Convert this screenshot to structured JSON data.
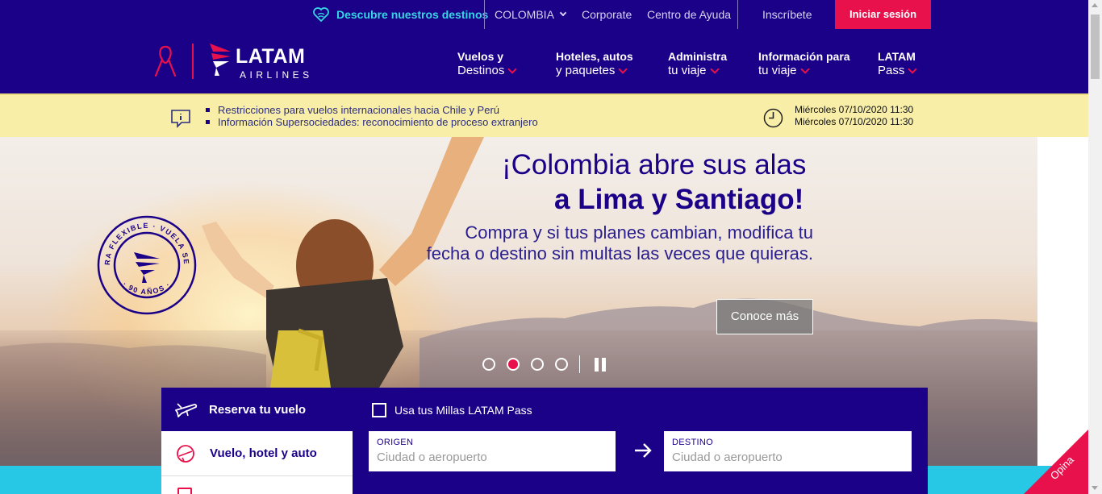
{
  "topbar": {
    "discover": "Descubre nuestros destinos",
    "country": "COLOMBIA",
    "corporate": "Corporate",
    "help": "Centro de Ayuda",
    "register": "Inscríbete",
    "login": "Iniciar sesión"
  },
  "brand": {
    "name": "LATAM",
    "subname": "AIRLINES"
  },
  "nav": [
    {
      "line1": "Vuelos y",
      "line2": "Destinos"
    },
    {
      "line1": "Hoteles, autos",
      "line2": "y paquetes"
    },
    {
      "line1": "Administra",
      "line2": "tu viaje"
    },
    {
      "line1": "Información para",
      "line2": "tu viaje"
    },
    {
      "line1": "LATAM",
      "line2": "Pass"
    }
  ],
  "alerts": {
    "items": [
      "Restricciones para vuelos internacionales hacia Chile y Perú",
      "Información Supersociedades: reconocimiento de proceso extranjero"
    ],
    "dates": [
      "Miércoles 07/10/2020 11:30",
      "Miércoles 07/10/2020 11:30"
    ]
  },
  "hero": {
    "title_line1": "¡Colombia abre sus alas",
    "title_line2": "a Lima y Santiago!",
    "subtitle_line1": "Compra y si tus planes cambian, modifica tu",
    "subtitle_line2": "fecha o destino sin multas las veces que quieras.",
    "cta": "Conoce más",
    "badge_top": "COMPRA FLEXIBLE · VUELA SEGURO",
    "badge_bottom": "· 90 AÑOS ·",
    "slides": 4,
    "active_slide": 2
  },
  "booking": {
    "tab_flight": "Reserva tu vuelo",
    "tab_package": "Vuelo, hotel y auto",
    "miles_label": "Usa tus Millas LATAM Pass",
    "origin_label": "ORIGEN",
    "origin_placeholder": "Ciudad o aeropuerto",
    "destination_label": "DESTINO",
    "destination_placeholder": "Ciudad o aeropuerto"
  },
  "feedback": "Opina",
  "colors": {
    "brand_indigo": "#1b0088",
    "brand_coral": "#e8114b",
    "alert_yellow": "#f8eea8",
    "accent_cyan": "#35d6e3"
  }
}
